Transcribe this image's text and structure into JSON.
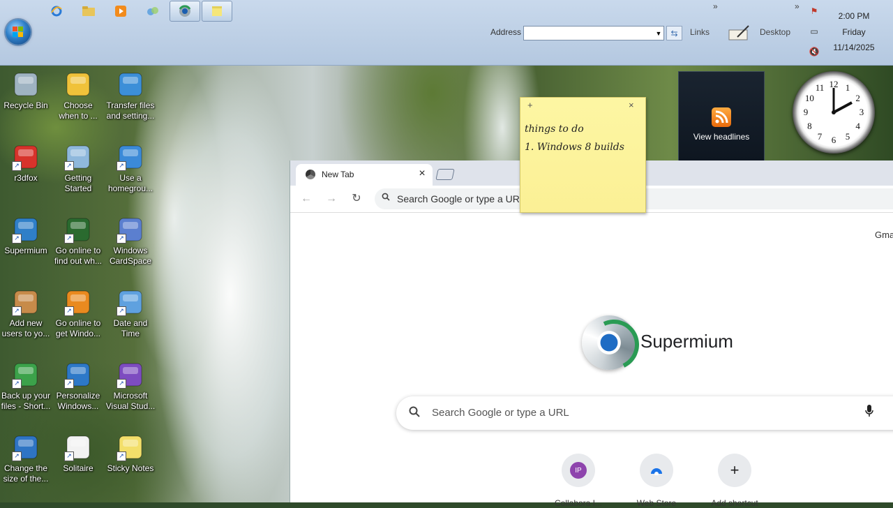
{
  "taskbar": {
    "address_label": "Address",
    "address_value": "",
    "links_label": "Links",
    "desktop_label": "Desktop",
    "clock": {
      "time": "2:00 PM",
      "day": "Friday",
      "date": "11/14/2025"
    }
  },
  "desktop_icons": [
    {
      "label": "Recycle Bin",
      "icon": "recycle-bin-icon",
      "shortcut": false
    },
    {
      "label": "Choose when to ...",
      "icon": "shield-icon",
      "shortcut": false
    },
    {
      "label": "Transfer files and setting...",
      "icon": "transfer-icon",
      "shortcut": false
    },
    {
      "label": "r3dfox",
      "icon": "r3dfox-icon",
      "shortcut": true
    },
    {
      "label": "Getting Started",
      "icon": "getting-started-icon",
      "shortcut": true
    },
    {
      "label": "Use a homegrou...",
      "icon": "homegroup-icon",
      "shortcut": true
    },
    {
      "label": "Supermium",
      "icon": "supermium-icon",
      "shortcut": true
    },
    {
      "label": "Go online to find out wh...",
      "icon": "media-center-icon",
      "shortcut": true
    },
    {
      "label": "Windows CardSpace",
      "icon": "cardspace-icon",
      "shortcut": true
    },
    {
      "label": "Add new users to yo...",
      "icon": "users-icon",
      "shortcut": true
    },
    {
      "label": "Go online to get Windo...",
      "icon": "windows-flag-icon",
      "shortcut": true
    },
    {
      "label": "Date and Time",
      "icon": "date-time-icon",
      "shortcut": true
    },
    {
      "label": "Back up your files - Short...",
      "icon": "backup-icon",
      "shortcut": true
    },
    {
      "label": "Personalize Windows...",
      "icon": "personalize-icon",
      "shortcut": true
    },
    {
      "label": "Microsoft Visual Stud...",
      "icon": "visual-studio-icon",
      "shortcut": true
    },
    {
      "label": "Change the size of the...",
      "icon": "display-icon",
      "shortcut": true
    },
    {
      "label": "Solitaire",
      "icon": "solitaire-icon",
      "shortcut": true
    },
    {
      "label": "Sticky Notes",
      "icon": "sticky-notes-icon",
      "shortcut": true
    }
  ],
  "browser": {
    "tab_title": "New Tab",
    "omnibox_placeholder": "Search Google or type a URL",
    "gmail_link": "Gma",
    "brand": "Supermium",
    "search_placeholder": "Search Google or type a URL",
    "shortcuts": [
      {
        "label": "Collabora I...",
        "badge": "IP"
      },
      {
        "label": "Web Store",
        "badge": ""
      },
      {
        "label": "Add shortcut",
        "badge": "+"
      }
    ]
  },
  "gadgets": {
    "headlines_label": "View headlines",
    "clock_numbers": [
      "12",
      "1",
      "2",
      "3",
      "4",
      "5",
      "6",
      "7",
      "8",
      "9",
      "10",
      "11"
    ]
  },
  "sticky_note": {
    "lines": [
      "things to do",
      "1. Windows 8 builds"
    ]
  },
  "colors": {
    "taskbar": "#c4d6ec",
    "sticky": "#fdf6a3",
    "accent": "#1a73e8"
  }
}
